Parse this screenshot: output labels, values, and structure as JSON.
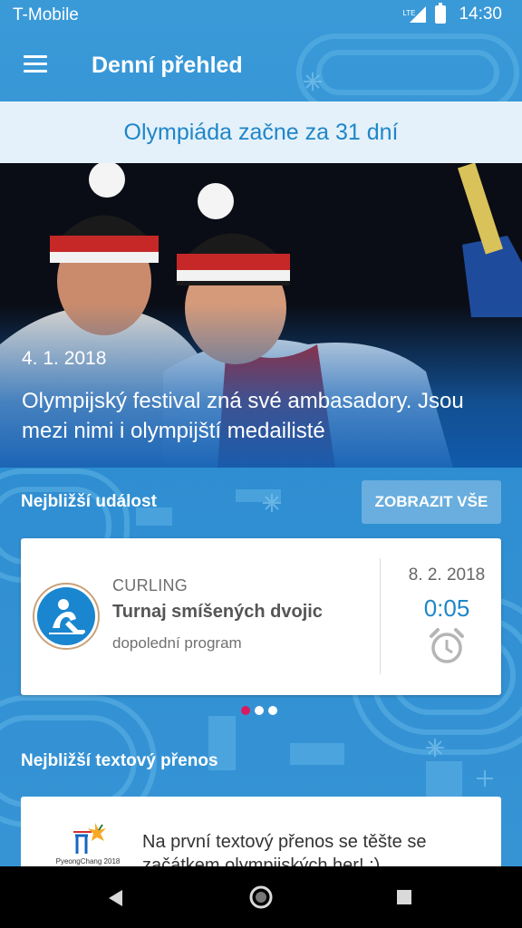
{
  "status_bar": {
    "carrier": "T-Mobile",
    "network": "LTE",
    "time": "14:30"
  },
  "app_bar": {
    "title": "Denní přehled"
  },
  "countdown": {
    "text": "Olympiáda začne za 31 dní"
  },
  "hero": {
    "date": "4. 1. 2018",
    "title": "Olympijský festival zná své ambasadory. Jsou mezi nimi i olympijští medailisté"
  },
  "nearest_event": {
    "heading": "Nejbližší událost",
    "show_all_label": "ZOBRAZIT VŠE",
    "card": {
      "sport": "CURLING",
      "name": "Turnaj smíšených dvojic",
      "subtitle": "dopolední program",
      "date": "8. 2. 2018",
      "time": "0:05"
    },
    "pager": {
      "count": 3,
      "active": 0
    }
  },
  "live_text": {
    "heading": "Nejbližší textový přenos",
    "logo_text": "PyeongChang 2018",
    "message": "Na první textový přenos se těšte se začátkem olympijských her! :)"
  },
  "colors": {
    "accent": "#1f86c8",
    "banner_bg": "#e4f1fa",
    "pager_active": "#d81b60"
  }
}
